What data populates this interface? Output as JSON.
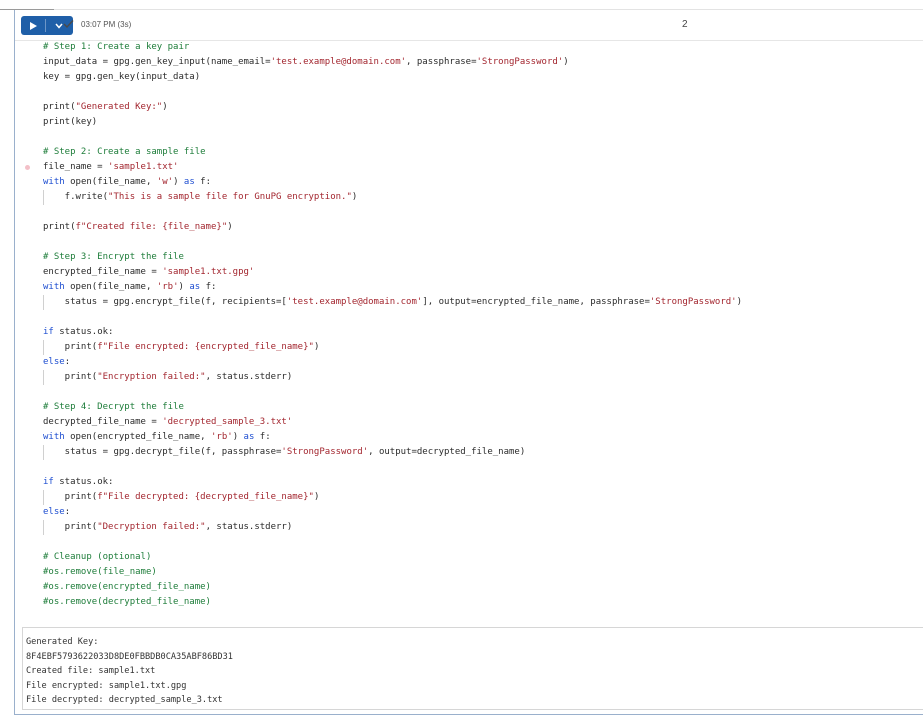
{
  "toolbar": {
    "exec_time": "03:07 PM (3s)",
    "exec_count": "2"
  },
  "code_lines": [
    "# Step 1: Create a key pair",
    "input_data = gpg.gen_key_input(name_email='test.example@domain.com', passphrase='StrongPassword')",
    "key = gpg.gen_key(input_data)",
    "",
    "print(\"Generated Key:\")",
    "print(key)",
    "",
    "# Step 2: Create a sample file",
    "file_name = 'sample1.txt'",
    "with open(file_name, 'w') as f:",
    "    f.write(\"This is a sample file for GnuPG encryption.\")",
    "",
    "print(f\"Created file: {file_name}\")",
    "",
    "# Step 3: Encrypt the file",
    "encrypted_file_name = 'sample1.txt.gpg'",
    "with open(file_name, 'rb') as f:",
    "    status = gpg.encrypt_file(f, recipients=['test.example@domain.com'], output=encrypted_file_name, passphrase='StrongPassword')",
    "",
    "if status.ok:",
    "    print(f\"File encrypted: {encrypted_file_name}\")",
    "else:",
    "    print(\"Encryption failed:\", status.stderr)",
    "",
    "# Step 4: Decrypt the file",
    "decrypted_file_name = 'decrypted_sample_3.txt'",
    "with open(encrypted_file_name, 'rb') as f:",
    "    status = gpg.decrypt_file(f, passphrase='StrongPassword', output=decrypted_file_name)",
    "",
    "if status.ok:",
    "    print(f\"File decrypted: {decrypted_file_name}\")",
    "else:",
    "    print(\"Decryption failed:\", status.stderr)",
    "",
    "# Cleanup (optional)",
    "#os.remove(file_name)",
    "#os.remove(encrypted_file_name)",
    "#os.remove(decrypted_file_name)"
  ],
  "output_lines": [
    "Generated Key:",
    "8F4EBF5793622033D8DE0FBBDB0CA35ABF86BD31",
    "Created file: sample1.txt",
    "File encrypted: sample1.txt.gpg",
    "File decrypted: decrypted_sample_3.txt"
  ],
  "colors": {
    "comment": "#1e7d3a",
    "keyword": "#1f4fd1",
    "string": "#a3262f",
    "run_button": "#1f5fa8"
  },
  "icons": {
    "run": "play-icon",
    "run_menu": "chevron-down-icon",
    "status": "check-icon"
  }
}
